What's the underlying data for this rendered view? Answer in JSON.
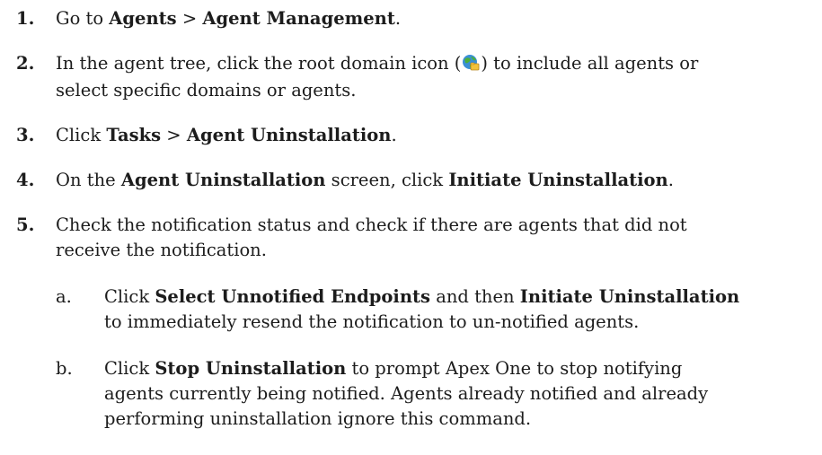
{
  "steps": [
    {
      "number": "1.",
      "parts": [
        "Go to ",
        "Agents",
        " > ",
        "Agent Management",
        "."
      ]
    },
    {
      "number": "2.",
      "line1_before": "In the agent tree, click the root domain icon (",
      "icon": "root-domain-globe-icon",
      "line1_after": ") to include all agents or",
      "line2": "select specific domains or agents."
    },
    {
      "number": "3.",
      "parts": [
        "Click ",
        "Tasks",
        " > ",
        "Agent Uninstallation",
        "."
      ]
    },
    {
      "number": "4.",
      "parts": [
        "On the ",
        "Agent Uninstallation",
        " screen, click ",
        "Initiate Uninstallation",
        "."
      ]
    },
    {
      "number": "5.",
      "line1": "Check the notification status and check if there are agents that did not",
      "line2": "receive the notification."
    }
  ],
  "substeps": [
    {
      "letter": "a.",
      "l1_a": "Click ",
      "l1_b": "Select Unnotified Endpoints",
      "l1_c": " and then ",
      "l1_d": "Initiate Uninstallation",
      "l2": "to immediately resend the notification to un-notified agents."
    },
    {
      "letter": "b.",
      "l1_a": "Click ",
      "l1_b": "Stop Uninstallation",
      "l1_c": " to prompt Apex One to stop notifying",
      "l2": "agents currently being notified. Agents already notified and already",
      "l3": "performing uninstallation ignore this command."
    }
  ],
  "colors": {
    "text": "#1c1c1c",
    "globe_blue": "#3a8fd6",
    "globe_green": "#4caf3c",
    "folder_yellow": "#f2c23a"
  }
}
